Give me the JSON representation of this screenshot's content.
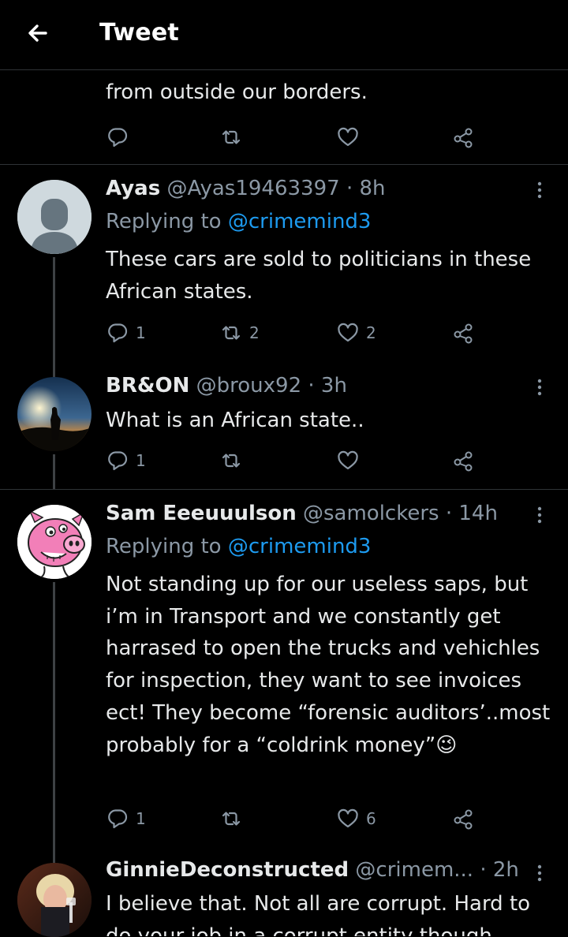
{
  "header": {
    "title": "Tweet"
  },
  "tail": {
    "text": "from outside our borders."
  },
  "tweets": [
    {
      "name": "Ayas",
      "handle": "@Ayas19463397",
      "time": "8h",
      "replying_prefix": "Replying to",
      "replying_to": "@crimemind3",
      "text": "These cars are sold to politicians in these African states.",
      "replies": "1",
      "retweets": "2",
      "likes": "2"
    },
    {
      "name": "BR&ON",
      "handle": "@broux92",
      "time": "3h",
      "text": "What is an African state..",
      "replies": "1",
      "retweets": "",
      "likes": ""
    },
    {
      "name": "Sam Eeeuuulson",
      "handle": "@samolckers",
      "time": "14h",
      "replying_prefix": "Replying to",
      "replying_to": "@crimemind3",
      "text": "Not standing up for our useless saps, but i’m in Transport and we constantly get harrased to open the trucks and vehichles for inspection, they want to see invoices ect! They become “forensic auditors’..most probably for a “coldrink money”",
      "emoji": "😉",
      "replies": "1",
      "retweets": "",
      "likes": "6"
    },
    {
      "name": "GinnieDeconstructed",
      "handle": "@crimem...",
      "time": "2h",
      "text": "I believe that. Not all are corrupt. Hard to do your job in a corrupt entity though"
    }
  ],
  "colors": {
    "background": "#000000",
    "text": "#e7e9ea",
    "muted": "#8b98a5",
    "link": "#1d9bf0",
    "divider": "#2f3336"
  },
  "icons": [
    "back-arrow-icon",
    "reply-icon",
    "retweet-icon",
    "like-icon",
    "share-icon",
    "more-icon"
  ]
}
